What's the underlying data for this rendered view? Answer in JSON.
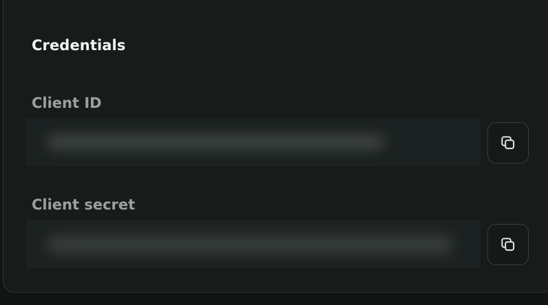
{
  "section": {
    "title": "Credentials"
  },
  "fields": [
    {
      "label": "Client ID",
      "value": "",
      "copy_icon": "copy-icon"
    },
    {
      "label": "Client secret",
      "value": "",
      "copy_icon": "copy-icon"
    }
  ],
  "colors": {
    "background": "#111514",
    "card": "#171c1b",
    "border": "#303635",
    "title": "#f3f5f4",
    "label": "#9aa09e"
  }
}
